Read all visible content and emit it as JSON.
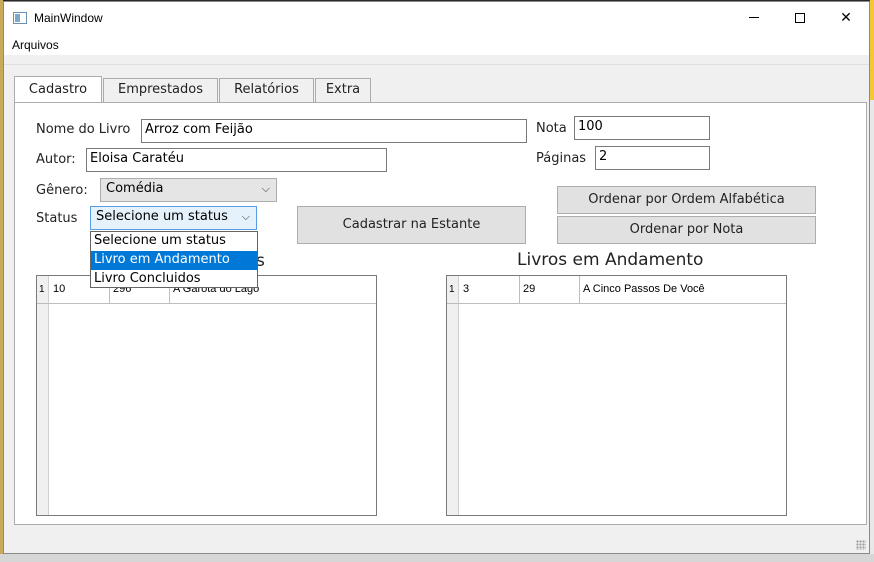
{
  "window": {
    "title": "MainWindow"
  },
  "menu": {
    "file_label": "Arquivos"
  },
  "tabs": [
    {
      "label": "Cadastro",
      "active": true
    },
    {
      "label": "Emprestados",
      "active": false
    },
    {
      "label": "Relatórios",
      "active": false
    },
    {
      "label": "Extra",
      "active": false
    }
  ],
  "form": {
    "name_label": "Nome do Livro",
    "name_value": "Arroz com Feijão",
    "author_label": "Autor:",
    "author_value": "Eloisa Caratéu",
    "genre_label": "Gênero:",
    "genre_value": "Comédia",
    "status_label": "Status",
    "status_value": "Selecione um status",
    "status_options": [
      "Selecione um status",
      "Livro em Andamento",
      "Livro Concluidos"
    ],
    "status_highlighted_index": 1,
    "nota_label": "Nota",
    "nota_value": "100",
    "pages_label": "Páginas",
    "pages_value": "2"
  },
  "buttons": {
    "register": "Cadastrar na Estante",
    "sort_alpha": "Ordenar por Ordem Alfabética",
    "sort_grade": "Ordenar por Nota"
  },
  "left_grid": {
    "heading_tail": "s",
    "rows": [
      {
        "num": "1",
        "cells": [
          "10",
          "296",
          "A Garota do Lago"
        ]
      }
    ]
  },
  "right_grid": {
    "heading": "Livros em Andamento",
    "rows": [
      {
        "num": "1",
        "cells": [
          "3",
          "29",
          "A Cinco Passos De Você"
        ]
      }
    ]
  },
  "colors": {
    "selection": "#0078d7",
    "panel": "#ffffff",
    "chrome": "#f0f0f0"
  }
}
